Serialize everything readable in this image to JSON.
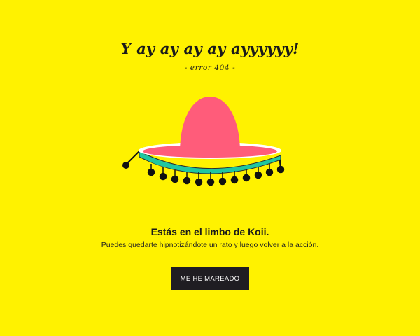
{
  "page": {
    "headline": "Y ay ay ay ay ayyyyyy!",
    "error_code": "- error 404 -",
    "message_title": "Estás en el limbo de Koii.",
    "message_subtitle": "Puedes quedarte hipnotizándote un rato y luego volver a la acción.",
    "button_label": "ME HE MAREADO"
  },
  "illustration": {
    "icon": "sombrero-icon",
    "colors": {
      "background": "#FFF200",
      "crown": "#FF5C7A",
      "brim_top": "#FF5C7A",
      "brim_rim": "#FFFFFF",
      "band": "#1FC7A0",
      "band_edge": "#2B2B2B",
      "pompoms": "#111111"
    }
  },
  "colors": {
    "button_bg": "#1f1d22",
    "button_text": "#ffffff",
    "text": "#1a1a1a"
  }
}
